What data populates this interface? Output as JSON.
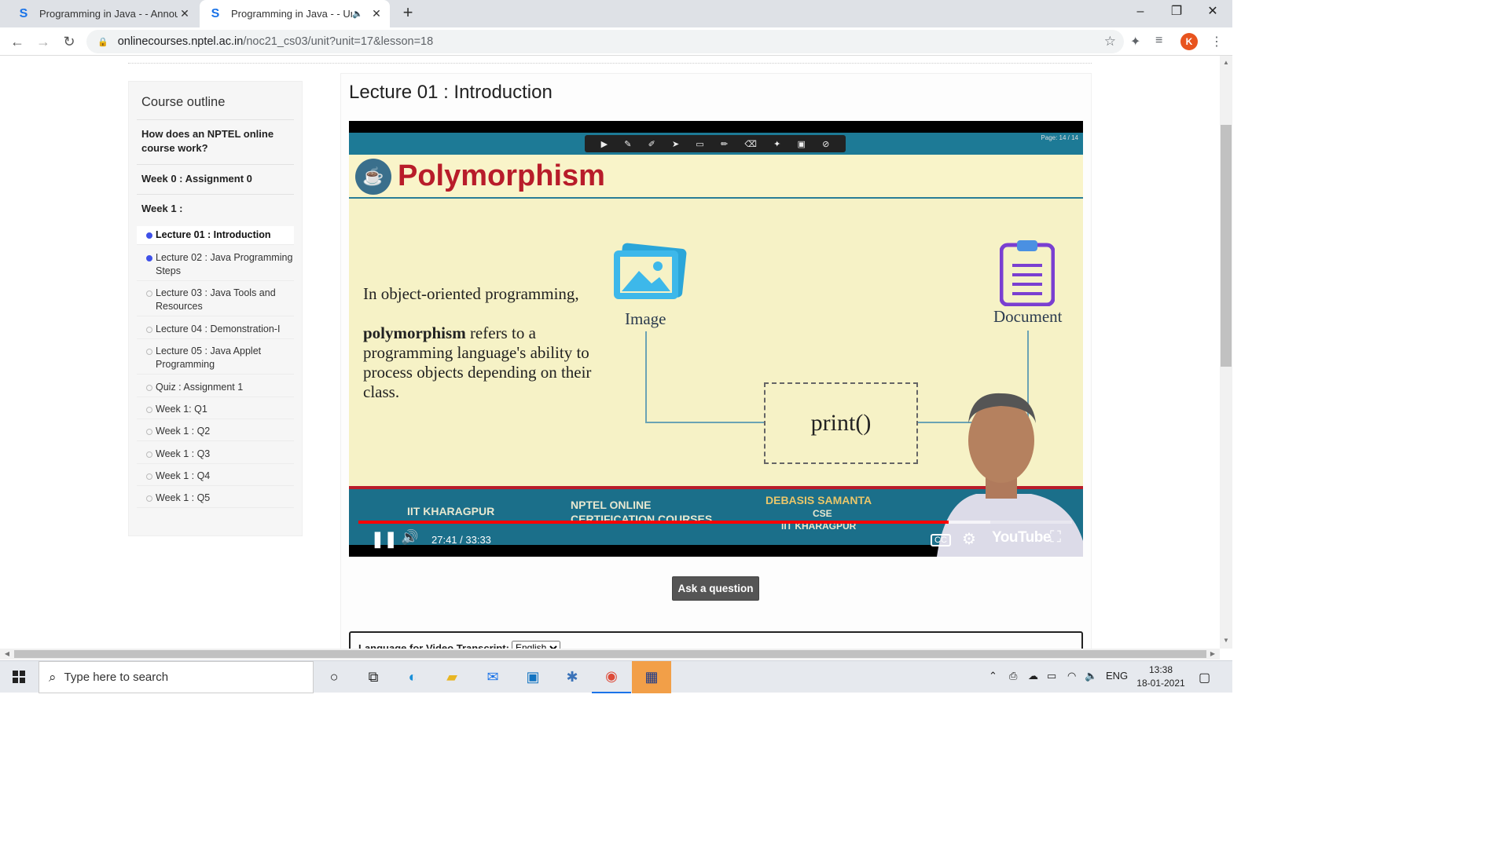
{
  "browser": {
    "tabs": [
      {
        "title": "Programming in Java - - Announ",
        "favicon": "S"
      },
      {
        "title": "Programming in Java - - Unit",
        "favicon": "S",
        "audio": true
      }
    ],
    "url_host": "onlinecourses.nptel.ac.in",
    "url_path": "/noc21_cs03/unit?unit=17&lesson=18",
    "profile_initial": "K"
  },
  "sidebar": {
    "heading": "Course outline",
    "sections": [
      "How does an NPTEL online course work?",
      "Week 0 : Assignment 0",
      "Week 1 :"
    ],
    "lessons": [
      {
        "label": "Lecture 01 : Introduction",
        "state": "watched",
        "active": true
      },
      {
        "label": "Lecture 02 : Java Programming Steps",
        "state": "watched",
        "active": false
      },
      {
        "label": "Lecture 03 : Java Tools and Resources",
        "state": "unwatched",
        "active": false
      },
      {
        "label": "Lecture 04 : Demonstration-I",
        "state": "unwatched",
        "active": false
      },
      {
        "label": "Lecture 05 : Java Applet Programming",
        "state": "unwatched",
        "active": false
      },
      {
        "label": "Quiz : Assignment 1",
        "state": "unwatched",
        "active": false
      },
      {
        "label": "Week 1: Q1",
        "state": "unwatched",
        "active": false
      },
      {
        "label": "Week 1 : Q2",
        "state": "unwatched",
        "active": false
      },
      {
        "label": "Week 1 : Q3",
        "state": "unwatched",
        "active": false
      },
      {
        "label": "Week 1 : Q4",
        "state": "unwatched",
        "active": false
      },
      {
        "label": "Week 1 : Q5",
        "state": "unwatched",
        "active": false
      }
    ]
  },
  "main": {
    "title": "Lecture 01 : Introduction",
    "ask_button": "Ask a question",
    "transcript_label": "Language for Video Transcript:",
    "transcript_language": "English"
  },
  "video": {
    "page_indicator": "Page: 14 / 14",
    "slide_title": "Polymorphism",
    "slide_intro": "In object-oriented programming,",
    "slide_term": "polymorphism",
    "slide_body": " refers to a programming language's ability to process objects depending on their class.",
    "image_label": "Image",
    "document_label": "Document",
    "print_label": "print()",
    "footer_left": "IIT KHARAGPUR",
    "footer_mid_1": "NPTEL ONLINE",
    "footer_mid_2": "CERTIFICATION COURSES",
    "footer_right_1": "DEBASIS SAMANTA",
    "footer_right_2": "CSE",
    "footer_right_3": "IIT KHARAGPUR",
    "time": "27:41 / 33:33",
    "played_fraction": 0.8275,
    "buffered_fraction": 0.885,
    "yt_logo": "YouTube"
  },
  "taskbar": {
    "search_placeholder": "Type here to search",
    "lang": "ENG",
    "time": "13:38",
    "date": "18-01-2021"
  },
  "colors": {
    "accent_dot": "#3f51e8",
    "slide_title": "#b81c2a",
    "progress": "#ff0000"
  }
}
